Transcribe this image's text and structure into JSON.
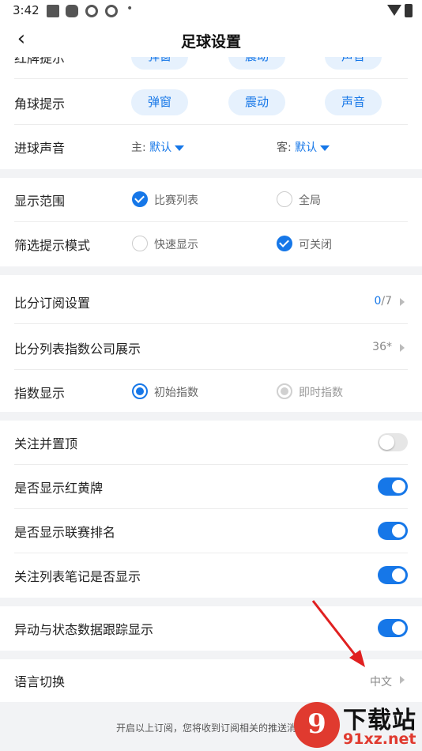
{
  "status_bar": {
    "time": "3:42",
    "dot": "•"
  },
  "header": {
    "back_icon": "‹",
    "title": "足球设置"
  },
  "red_card_row": {
    "label": "红牌提示",
    "options": [
      "弹窗",
      "震动",
      "声音"
    ]
  },
  "corner_row": {
    "label": "角球提示",
    "options": [
      "弹窗",
      "震动",
      "声音"
    ]
  },
  "goal_sound": {
    "label": "进球声音",
    "home_label": "主:",
    "home_value": "默认",
    "away_label": "客:",
    "away_value": "默认"
  },
  "display_range": {
    "label": "显示范围",
    "option1": "比赛列表",
    "option1_checked": true,
    "option2": "全局",
    "option2_checked": false
  },
  "filter_mode": {
    "label": "筛选提示模式",
    "option1": "快速显示",
    "option1_checked": false,
    "option2": "可关闭",
    "option2_checked": true
  },
  "score_sub": {
    "label": "比分订阅设置",
    "value_active": "0",
    "value_rest": "/7"
  },
  "score_index": {
    "label": "比分列表指数公司展示",
    "value": "36*"
  },
  "index_display": {
    "label": "指数显示",
    "option1": "初始指数",
    "option2": "即时指数"
  },
  "toggles": [
    {
      "label": "关注并置顶",
      "on": false
    },
    {
      "label": "是否显示红黄牌",
      "on": true
    },
    {
      "label": "是否显示联赛排名",
      "on": true
    },
    {
      "label": "关注列表笔记是否显示",
      "on": true
    }
  ],
  "anomaly": {
    "label": "异动与状态数据跟踪显示",
    "on": true
  },
  "language": {
    "label": "语言切换",
    "value": "中文"
  },
  "footer": {
    "note": "开启以上订阅，您将收到订阅相关的推送消息"
  },
  "watermark": {
    "logo": "9",
    "brand": "下载站",
    "url": "91xz.net"
  },
  "colors": {
    "accent": "#1677e8",
    "pill_bg": "#e6f1fd",
    "arrow": "#e02020"
  }
}
